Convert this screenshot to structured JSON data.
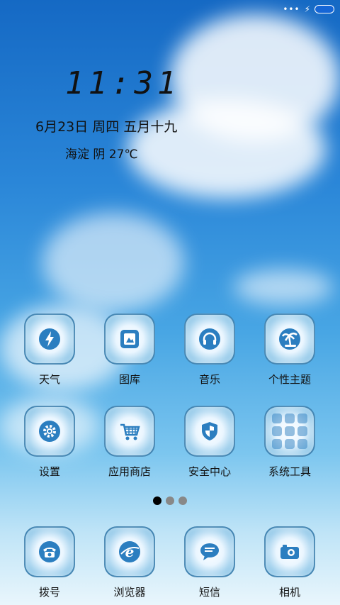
{
  "status": {
    "battery_color": "#1566d6"
  },
  "clock": {
    "time": "11:31"
  },
  "date_line": "6月23日  周四  五月十九",
  "weather_line": "海淀   阴   27℃",
  "apps": [
    {
      "label": "天气",
      "icon": "lightning-icon"
    },
    {
      "label": "图库",
      "icon": "photo-icon"
    },
    {
      "label": "音乐",
      "icon": "headphones-icon"
    },
    {
      "label": "个性主题",
      "icon": "palm-tree-icon"
    },
    {
      "label": "设置",
      "icon": "gear-icon"
    },
    {
      "label": "应用商店",
      "icon": "shopping-cart-icon"
    },
    {
      "label": "安全中心",
      "icon": "shield-icon"
    },
    {
      "label": "系统工具",
      "icon": "tools-folder-icon"
    }
  ],
  "pager": {
    "pages": 3,
    "active": 1
  },
  "dock": [
    {
      "label": "拨号",
      "icon": "telephone-icon"
    },
    {
      "label": "浏览器",
      "icon": "browser-icon"
    },
    {
      "label": "短信",
      "icon": "message-icon"
    },
    {
      "label": "相机",
      "icon": "camera-icon"
    }
  ]
}
